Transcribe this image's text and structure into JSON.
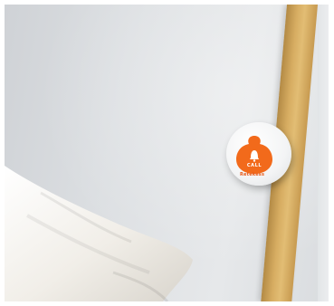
{
  "photo": {
    "subject": "",
    "button_text": "CALL",
    "brand_text": "Retekess",
    "accent_color": "#f26a1b",
    "wall_color": "#dcdfe2",
    "wood_color": "#d7ad62",
    "pillow_color": "#f1eee8",
    "icons": [
      "bell-icon"
    ]
  }
}
